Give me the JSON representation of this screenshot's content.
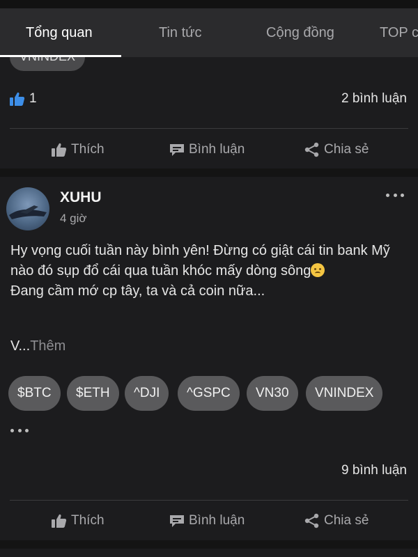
{
  "tabs": [
    {
      "label": "Tổng quan",
      "active": true
    },
    {
      "label": "Tin tức",
      "active": false
    },
    {
      "label": "Cộng đồng",
      "active": false
    },
    {
      "label": "TOP c",
      "active": false
    }
  ],
  "prev_post": {
    "partial_tag": "VNINDEX",
    "likes": "1",
    "comments": "2 bình luận"
  },
  "actions": {
    "like": "Thích",
    "comment": "Bình luận",
    "share": "Chia sẻ"
  },
  "post": {
    "author": "XUHU",
    "time": "4 giờ",
    "body_line1": "Hy vọng cuối tuần này bình yên! Đừng có giật cái tin bank Mỹ nào đó sụp đổ cái qua tuần khóc mấy dòng sông",
    "body_line2": "Đang cầm mớ cp tây, ta và cả coin nữa...",
    "more_prefix": "V...",
    "more_label": "Thêm",
    "tags": [
      "$BTC",
      "$ETH",
      "^DJI",
      "^GSPC",
      "VN30",
      "VNINDEX"
    ],
    "comments": "9 bình luận"
  },
  "colors": {
    "background": "#1c1c1e",
    "tabbar": "#2b2b2d",
    "like_accent": "#3d8ee8",
    "tag_bg": "#5a5a5c"
  }
}
